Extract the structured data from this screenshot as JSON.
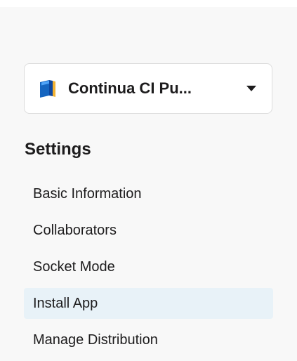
{
  "app_selector": {
    "app_name": "Continua CI Pu...",
    "icon": "book-icon",
    "caret_icon": "caret-down-icon"
  },
  "settings": {
    "title": "Settings",
    "items": [
      {
        "label": "Basic Information",
        "active": false
      },
      {
        "label": "Collaborators",
        "active": false
      },
      {
        "label": "Socket Mode",
        "active": false
      },
      {
        "label": "Install App",
        "active": true
      },
      {
        "label": "Manage Distribution",
        "active": false
      }
    ]
  },
  "colors": {
    "active_background": "#e8f2f8",
    "page_background": "#f8f8f8",
    "text": "#1d1c1d"
  }
}
